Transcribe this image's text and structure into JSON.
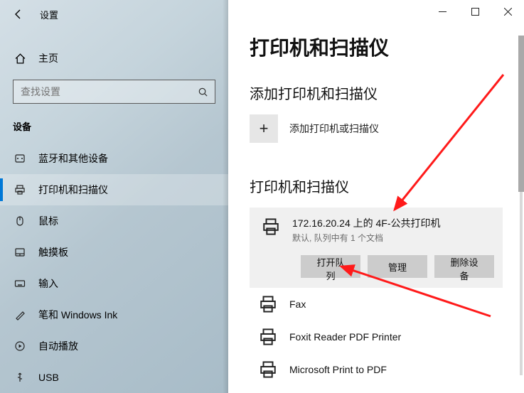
{
  "titlebar": {
    "title": "设置"
  },
  "sidebar": {
    "home": "主页",
    "search_placeholder": "查找设置",
    "section": "设备",
    "items": [
      {
        "label": "蓝牙和其他设备"
      },
      {
        "label": "打印机和扫描仪"
      },
      {
        "label": "鼠标"
      },
      {
        "label": "触摸板"
      },
      {
        "label": "输入"
      },
      {
        "label": "笔和 Windows Ink"
      },
      {
        "label": "自动播放"
      },
      {
        "label": "USB"
      }
    ]
  },
  "main": {
    "heading": "打印机和扫描仪",
    "add_section": "添加打印机和扫描仪",
    "add_label": "添加打印机或扫描仪",
    "list_section": "打印机和扫描仪",
    "selected": {
      "name": "172.16.20.24 上的 4F-公共打印机",
      "status": "默认, 队列中有 1 个文档",
      "open_queue": "打开队列",
      "manage": "管理",
      "remove": "删除设备"
    },
    "others": [
      {
        "name": "Fax"
      },
      {
        "name": "Foxit Reader PDF Printer"
      },
      {
        "name": "Microsoft Print to PDF"
      }
    ]
  }
}
